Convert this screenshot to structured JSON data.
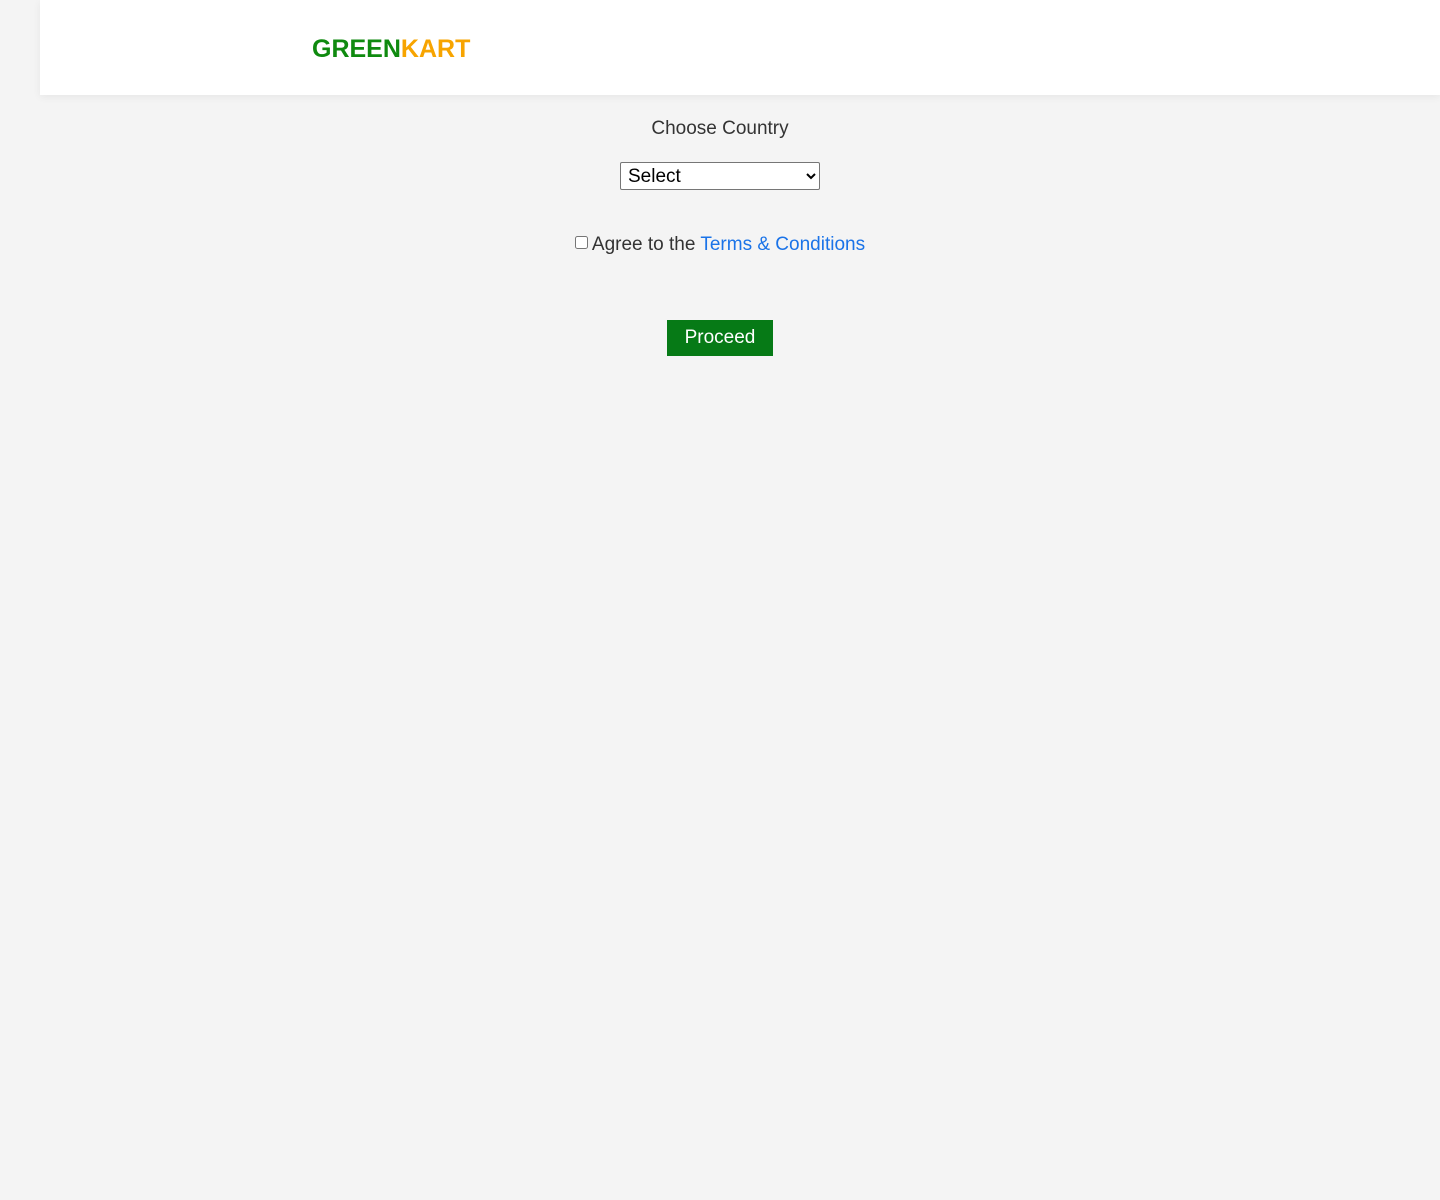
{
  "header": {
    "brand_part1": "GREEN",
    "brand_part2": "KART"
  },
  "form": {
    "choose_country_label": "Choose Country",
    "country_select": {
      "selected": "Select",
      "options": [
        "Select"
      ]
    },
    "agree_prefix": "Agree to the",
    "terms_link": "Terms & Conditions",
    "agree_checked": false,
    "proceed_label": "Proceed"
  },
  "colors": {
    "brand_green": "#0f8a0f",
    "brand_orange": "#f7a400",
    "link_blue": "#1a73e8",
    "button_green": "#067a16",
    "page_background": "#f4f4f4",
    "header_background": "#ffffff"
  }
}
